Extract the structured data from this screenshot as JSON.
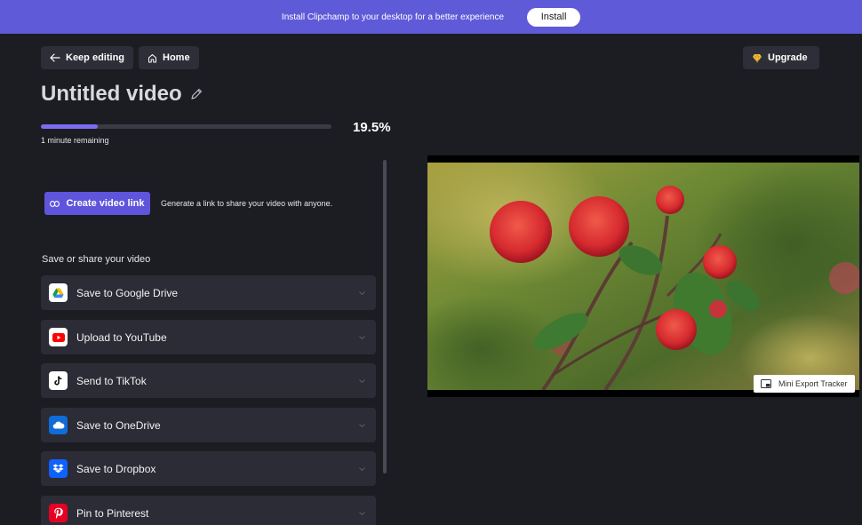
{
  "banner": {
    "text": "Install Clipchamp to your desktop for a better experience",
    "install_label": "Install"
  },
  "nav": {
    "keep_editing_label": "Keep editing",
    "home_label": "Home",
    "upgrade_label": "Upgrade"
  },
  "project": {
    "title": "Untitled video"
  },
  "export": {
    "progress_fraction": 0.195,
    "progress_text": "19.5%",
    "remaining_text": "1 minute remaining"
  },
  "link": {
    "button_label": "Create video link",
    "description": "Generate a link to share your video with anyone."
  },
  "share": {
    "section_label": "Save or share your video",
    "items": [
      {
        "label": "Save to Google Drive",
        "icon": "google-drive-icon"
      },
      {
        "label": "Upload to YouTube",
        "icon": "youtube-icon"
      },
      {
        "label": "Send to TikTok",
        "icon": "tiktok-icon"
      },
      {
        "label": "Save to OneDrive",
        "icon": "onedrive-icon"
      },
      {
        "label": "Save to Dropbox",
        "icon": "dropbox-icon"
      },
      {
        "label": "Pin to Pinterest",
        "icon": "pinterest-icon"
      }
    ]
  },
  "preview": {
    "mini_tracker_label": "Mini Export Tracker"
  },
  "colors": {
    "banner": "#5f5ad8",
    "background": "#1c1c23",
    "accent": "#5f54dc",
    "progress": "#7b6cf0",
    "row": "#2c2c36"
  }
}
